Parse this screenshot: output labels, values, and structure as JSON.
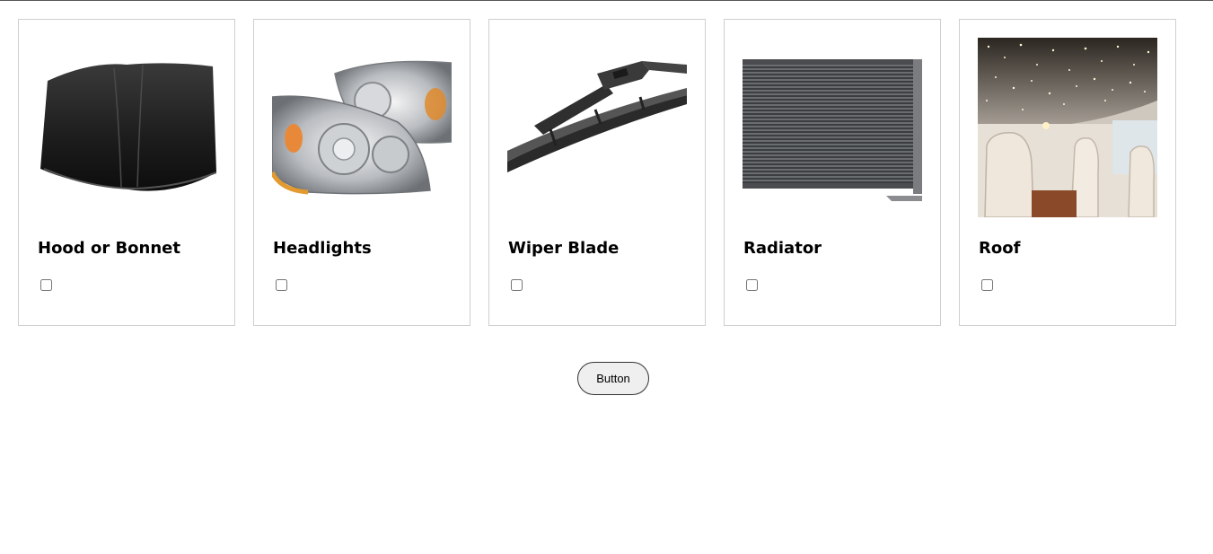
{
  "cards": [
    {
      "title": "Hood or Bonnet",
      "image": "car-hood-image",
      "checked": false
    },
    {
      "title": "Headlights",
      "image": "headlights-image",
      "checked": false
    },
    {
      "title": "Wiper Blade",
      "image": "wiper-blade-image",
      "checked": false
    },
    {
      "title": "Radiator",
      "image": "radiator-image",
      "checked": false
    },
    {
      "title": "Roof",
      "image": "starlight-roof-image",
      "checked": false
    }
  ],
  "submit_button": {
    "label": "Button"
  }
}
